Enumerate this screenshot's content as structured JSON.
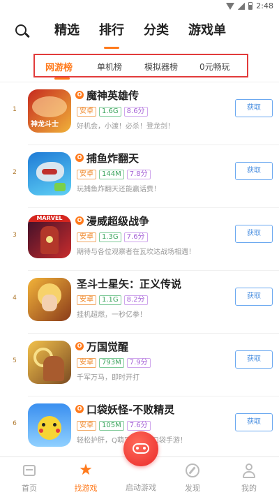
{
  "status_bar": {
    "time": "2:48"
  },
  "main_tabs": [
    "精选",
    "排行",
    "分类",
    "游戏单"
  ],
  "sub_tabs": [
    "网游榜",
    "单机榜",
    "模拟器榜",
    "0元畅玩"
  ],
  "apps": [
    {
      "rank": "1",
      "name": "魔神英雄传",
      "platform": "安卓",
      "size": "1.6G",
      "score": "8.6分",
      "desc": "好机会，小渡！必杀！登龙剑！",
      "button": "获取",
      "icon_text": "神龙斗士",
      "icon_colors": [
        "#c62a1f",
        "#f0b23a"
      ]
    },
    {
      "rank": "2",
      "name": "捕鱼炸翻天",
      "platform": "安卓",
      "size": "144M",
      "score": "7.8分",
      "desc": "玩捕鱼炸翻天还能赢话费！",
      "button": "获取",
      "icon_text": "",
      "icon_colors": [
        "#1f7bd6",
        "#5fd0f5"
      ]
    },
    {
      "rank": "3",
      "name": "漫威超级战争",
      "platform": "安卓",
      "size": "1.3G",
      "score": "7.6分",
      "desc": "期待与各位观察者在瓦坎达战场相遇！",
      "button": "获取",
      "icon_text": "MARVEL",
      "icon_colors": [
        "#7a1a1a",
        "#c92c2c"
      ]
    },
    {
      "rank": "4",
      "name": "圣斗士星矢：正义传说",
      "platform": "安卓",
      "size": "1.1G",
      "score": "8.2分",
      "desc": "挂机超燃，一秒亿拳！",
      "button": "获取",
      "icon_text": "",
      "icon_colors": [
        "#f2b33a",
        "#8a3b1a"
      ]
    },
    {
      "rank": "5",
      "name": "万国觉醒",
      "platform": "安卓",
      "size": "793M",
      "score": "7.9分",
      "desc": "千军万马，即时开打",
      "button": "获取",
      "icon_text": "",
      "icon_colors": [
        "#f3c24c",
        "#7a4a22"
      ]
    },
    {
      "rank": "6",
      "name": "口袋妖怪-不败精灵",
      "platform": "安卓",
      "size": "105M",
      "score": "7.6分",
      "desc": "轻松护肝，Q萌又好玩的口袋手游！",
      "button": "获取",
      "icon_text": "",
      "icon_colors": [
        "#3a8ff0",
        "#f5d43a"
      ]
    }
  ],
  "bottom_nav": {
    "home": "首页",
    "find_games": "找游戏",
    "launch_game": "启动游戏",
    "discover": "发现",
    "mine": "我的"
  },
  "colors": {
    "accent": "#ff7a1c",
    "highlight_box": "#e23b3b",
    "button_blue": "#4a8fe0"
  }
}
